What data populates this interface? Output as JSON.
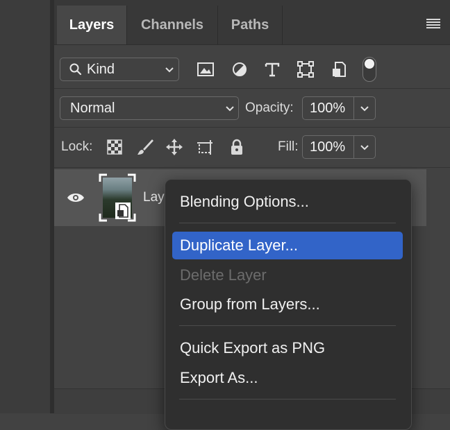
{
  "tabs": [
    {
      "label": "Layers",
      "active": true
    },
    {
      "label": "Channels",
      "active": false
    },
    {
      "label": "Paths",
      "active": false
    }
  ],
  "filter": {
    "kind_label": "Kind",
    "icons": [
      "image-filter-icon",
      "adjustment-filter-icon",
      "type-filter-icon",
      "shape-filter-icon",
      "smart-object-filter-icon"
    ]
  },
  "blend": {
    "mode": "Normal",
    "opacity_label": "Opacity:",
    "opacity_value": "100%"
  },
  "lock": {
    "label": "Lock:",
    "fill_label": "Fill:",
    "fill_value": "100%"
  },
  "layer": {
    "name": "Lay"
  },
  "context_menu": {
    "items": [
      {
        "label": "Blending Options...",
        "state": "normal"
      },
      {
        "label": "Duplicate Layer...",
        "state": "selected"
      },
      {
        "label": "Delete Layer",
        "state": "disabled"
      },
      {
        "label": "Group from Layers...",
        "state": "normal"
      },
      {
        "label": "Quick Export as PNG",
        "state": "normal"
      },
      {
        "label": "Export As...",
        "state": "normal"
      }
    ]
  },
  "colors": {
    "panel_bg": "#424242",
    "menu_bg": "#2f2f2f",
    "highlight": "#3264c8",
    "layer_row": "#555555"
  }
}
